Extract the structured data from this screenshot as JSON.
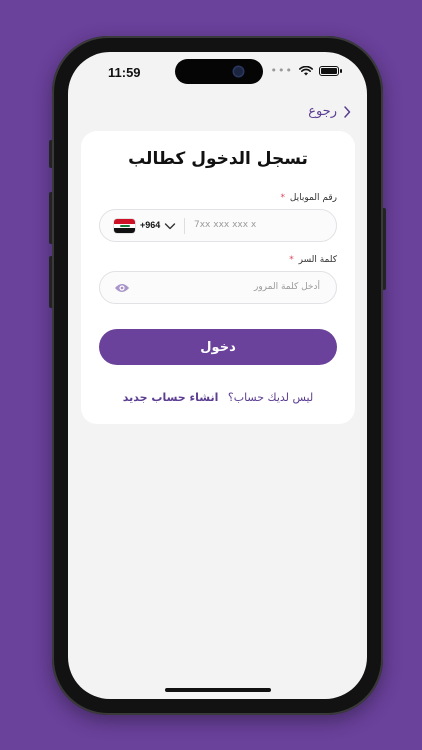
{
  "status_bar": {
    "time": "11:59",
    "signal_dots": "•••"
  },
  "nav": {
    "back_label": "رجوع"
  },
  "login_card": {
    "title": "تسجل الدخول كطالب",
    "phone_field": {
      "label": "رقم الموبايل",
      "required_mark": "*",
      "country_code": "+964",
      "placeholder": "7xx xxx xxx x"
    },
    "password_field": {
      "label": "كلمة السر",
      "required_mark": "*",
      "placeholder": "أدخل كلمة المرور"
    },
    "login_button": "دخول",
    "signup_prompt": "ليس لديك حساب؟",
    "signup_link": "انشاء حساب جديد"
  },
  "colors": {
    "background": "#6a419b",
    "accent": "#6a419b",
    "link": "#5b3d91",
    "required": "#e0445a"
  },
  "icons": {
    "back": "chevron-right-icon",
    "flag": "iraq-flag-icon",
    "dropdown": "chevron-down-icon",
    "password_toggle": "eye-icon",
    "wifi": "wifi-icon",
    "battery": "battery-icon"
  }
}
